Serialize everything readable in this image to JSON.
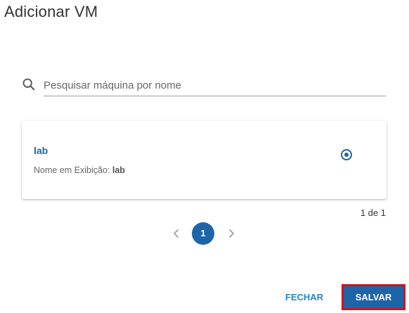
{
  "dialog": {
    "title": "Adicionar VM"
  },
  "search": {
    "placeholder": "Pesquisar máquina por nome",
    "value": "",
    "icon": "search-icon"
  },
  "vm_list": [
    {
      "name": "lab",
      "display_label": "Nome em Exibição:",
      "display_value": "lab",
      "selected": true
    }
  ],
  "pagination": {
    "summary": "1 de 1",
    "current_page": "1",
    "prev_icon": "chevron-left-icon",
    "next_icon": "chevron-right-icon"
  },
  "actions": {
    "close_label": "FECHAR",
    "save_label": "SALVAR"
  },
  "colors": {
    "primary": "#1e64a8",
    "link": "#1e88d0",
    "highlight_border": "#d0141e",
    "text": "#333333",
    "muted": "#666666"
  }
}
